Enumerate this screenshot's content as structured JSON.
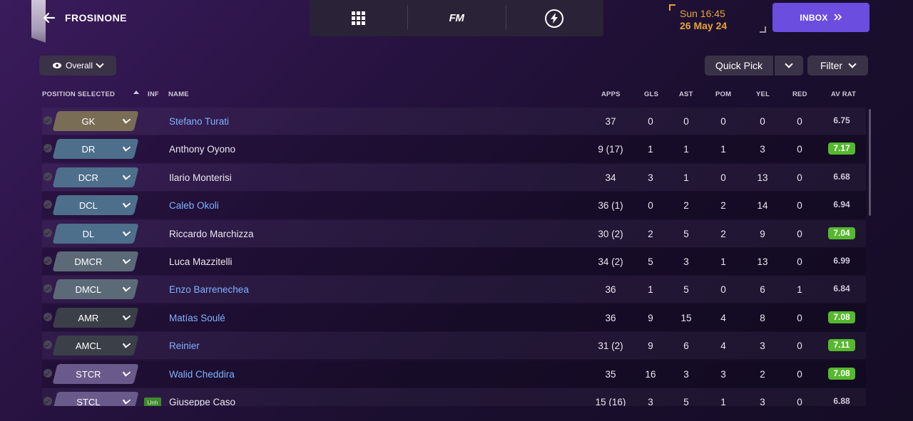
{
  "header": {
    "club_name": "FROSINONE",
    "hub_logo": "FM",
    "date_day": "Sun 16:45",
    "date_date": "26 May 24",
    "inbox_label": "INBOX",
    "icons": [
      "back-arrow-icon",
      "grid-menu-icon",
      "fm-logo",
      "bolt-icon",
      "double-chevron-icon"
    ]
  },
  "toolbar": {
    "view_label": "Overall",
    "quick_pick_label": "Quick Pick",
    "filter_label": "Filter"
  },
  "columns": {
    "position_selected": "POSITION SELECTED",
    "inf": "INF",
    "name": "NAME",
    "apps": "APPS",
    "gls": "GLS",
    "ast": "AST",
    "pom": "POM",
    "yel": "YEL",
    "red": "RED",
    "av_rat": "AV RAT"
  },
  "players": [
    {
      "pos": "GK",
      "pos_color": "#7a6d55",
      "name": "Stefano Turati",
      "link": true,
      "inf": "",
      "apps": "37",
      "gls": "0",
      "ast": "0",
      "pom": "0",
      "yel": "0",
      "red": "0",
      "rat": "6.75",
      "good": false
    },
    {
      "pos": "DR",
      "pos_color": "#4e6f8c",
      "name": "Anthony Oyono",
      "link": false,
      "inf": "",
      "apps": "9 (17)",
      "gls": "1",
      "ast": "1",
      "pom": "1",
      "yel": "3",
      "red": "0",
      "rat": "7.17",
      "good": true
    },
    {
      "pos": "DCR",
      "pos_color": "#4e6f8c",
      "name": "Ilario Monterisi",
      "link": false,
      "inf": "",
      "apps": "34",
      "gls": "3",
      "ast": "1",
      "pom": "0",
      "yel": "13",
      "red": "0",
      "rat": "6.68",
      "good": false
    },
    {
      "pos": "DCL",
      "pos_color": "#4e6f8c",
      "name": "Caleb Okoli",
      "link": true,
      "inf": "",
      "apps": "36 (1)",
      "gls": "0",
      "ast": "2",
      "pom": "2",
      "yel": "14",
      "red": "0",
      "rat": "6.94",
      "good": false
    },
    {
      "pos": "DL",
      "pos_color": "#4e6f8c",
      "name": "Riccardo Marchizza",
      "link": false,
      "inf": "",
      "apps": "30 (2)",
      "gls": "2",
      "ast": "5",
      "pom": "2",
      "yel": "9",
      "red": "0",
      "rat": "7.04",
      "good": true
    },
    {
      "pos": "DMCR",
      "pos_color": "#5c6a78",
      "name": "Luca Mazzitelli",
      "link": false,
      "inf": "",
      "apps": "34 (2)",
      "gls": "5",
      "ast": "3",
      "pom": "1",
      "yel": "13",
      "red": "0",
      "rat": "6.99",
      "good": false
    },
    {
      "pos": "DMCL",
      "pos_color": "#5c6a78",
      "name": "Enzo Barrenechea",
      "link": true,
      "inf": "",
      "apps": "36",
      "gls": "1",
      "ast": "5",
      "pom": "0",
      "yel": "6",
      "red": "1",
      "rat": "6.84",
      "good": false
    },
    {
      "pos": "AMR",
      "pos_color": "#3a3f48",
      "name": "Matías Soulé",
      "link": true,
      "inf": "",
      "apps": "36",
      "gls": "9",
      "ast": "15",
      "pom": "4",
      "yel": "8",
      "red": "0",
      "rat": "7.08",
      "good": true
    },
    {
      "pos": "AMCL",
      "pos_color": "#3a3f48",
      "name": "Reinier",
      "link": true,
      "inf": "",
      "apps": "31 (2)",
      "gls": "9",
      "ast": "6",
      "pom": "4",
      "yel": "3",
      "red": "0",
      "rat": "7.11",
      "good": true
    },
    {
      "pos": "STCR",
      "pos_color": "#6a5a8c",
      "name": "Walid Cheddira",
      "link": true,
      "inf": "",
      "apps": "35",
      "gls": "16",
      "ast": "3",
      "pom": "3",
      "yel": "2",
      "red": "0",
      "rat": "7.08",
      "good": true
    },
    {
      "pos": "STCL",
      "pos_color": "#6a5a8c",
      "name": "Giuseppe Caso",
      "link": false,
      "inf": "Unh",
      "apps": "15 (16)",
      "gls": "3",
      "ast": "5",
      "pom": "1",
      "yel": "3",
      "red": "0",
      "rat": "6.88",
      "good": false
    }
  ]
}
